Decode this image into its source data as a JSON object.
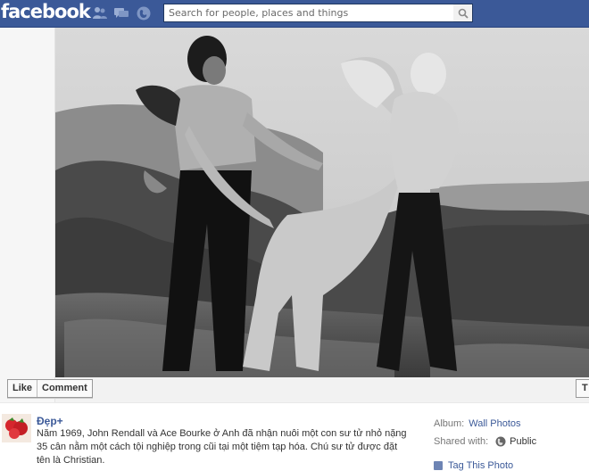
{
  "header": {
    "logo": "facebook",
    "search_placeholder": "Search for people, places and things",
    "icons": [
      "friend-requests-icon",
      "messages-icon",
      "notifications-icon",
      "search-icon"
    ]
  },
  "photo": {
    "alt": "Black and white photo of two men and a lion"
  },
  "actions": {
    "like": "Like",
    "comment": "Comment",
    "tag_partial": "T"
  },
  "post": {
    "author": "Đẹp+",
    "description": "Năm 1969, John Rendall và Ace Bourke ở Anh đã nhận nuôi một con sư tử nhỏ nặng 35 cân nằm một cách tội nghiệp trong cũi tại một tiệm tạp hóa. Chú sư tử được đặt tên là Christian."
  },
  "meta": {
    "album_label": "Album:",
    "album_value": "Wall Photos",
    "shared_label": "Shared with:",
    "shared_value": "Public",
    "tag_photo": "Tag This Photo"
  },
  "colors": {
    "brand": "#3b5998",
    "link": "#3b5998"
  }
}
